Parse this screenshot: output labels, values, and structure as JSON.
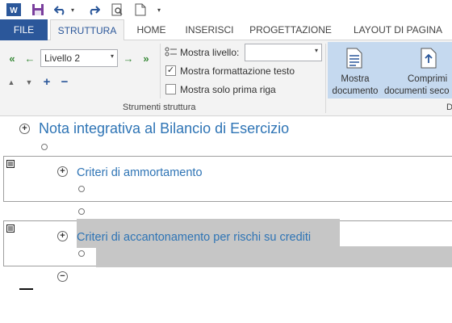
{
  "qat": {
    "icons": [
      "word-icon",
      "save-icon",
      "undo-icon",
      "undo-dropdown-icon",
      "redo-icon",
      "print-preview-icon",
      "new-document-icon",
      "customize-qat-icon"
    ]
  },
  "tabs": [
    {
      "label": "FILE"
    },
    {
      "label": "STRUTTURA"
    },
    {
      "label": "HOME"
    },
    {
      "label": "INSERISCI"
    },
    {
      "label": "PROGETTAZIONE"
    },
    {
      "label": "LAYOUT DI PAGINA"
    }
  ],
  "ribbon": {
    "level_select": {
      "value": "Livello 2"
    },
    "show_level": {
      "label": "Mostra livello:",
      "value": ""
    },
    "show_formatting": {
      "label": "Mostra formattazione testo",
      "checked": true
    },
    "show_first_line": {
      "label": "Mostra solo prima riga",
      "checked": false
    },
    "group_label": "Strumenti struttura",
    "show_document": {
      "line1": "Mostra",
      "line2": "documento"
    },
    "collapse_subdocs": {
      "line1": "Comprimi",
      "line2": "documenti seco"
    },
    "cut_letter": "D"
  },
  "document": {
    "heading1": "Nota integrativa al Bilancio di Esercizio",
    "heading2_a": "Criteri di ammortamento",
    "heading2_b": "Criteri di accantonamento per rischi su crediti"
  },
  "colors": {
    "file_tab": "#2b579a",
    "heading": "#2e74b5",
    "selection": "#c6c6c6",
    "ribbon_bg": "#f3f3f3",
    "highlight_group": "#c5d9ef"
  }
}
